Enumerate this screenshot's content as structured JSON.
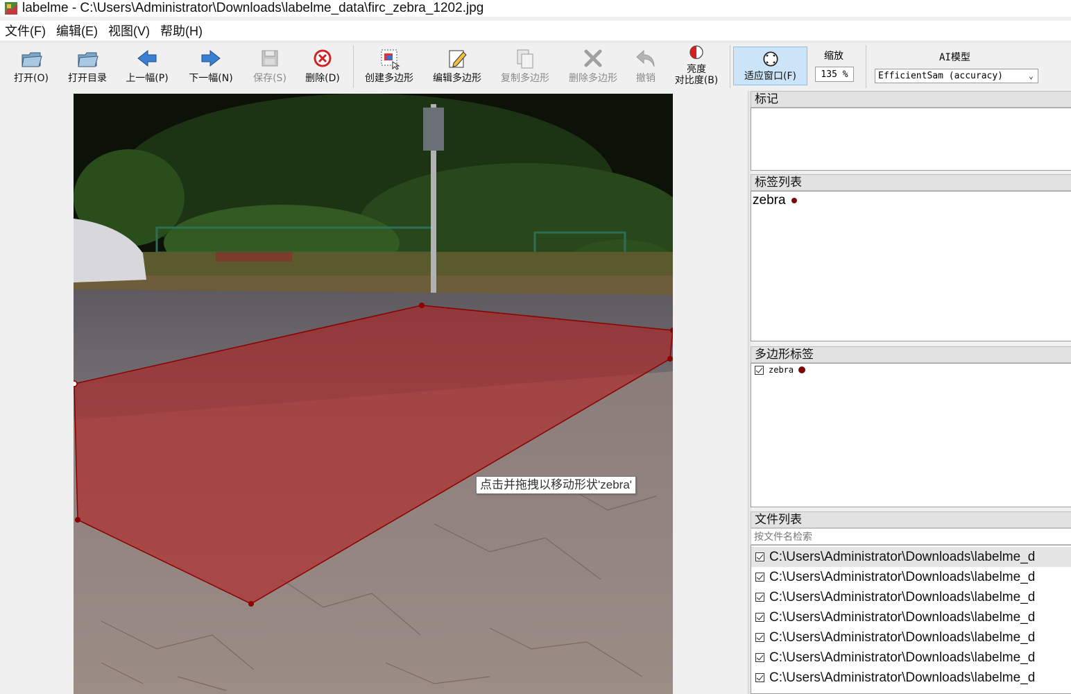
{
  "window": {
    "title": "labelme - C:\\Users\\Administrator\\Downloads\\labelme_data\\firc_zebra_1202.jpg"
  },
  "menu": [
    "文件(F)",
    "编辑(E)",
    "视图(V)",
    "帮助(H)"
  ],
  "toolbar": {
    "open": "打开(O)",
    "open_dir": "打开目录",
    "prev": "上一幅(P)",
    "next": "下一幅(N)",
    "save": "保存(S)",
    "delete": "删除(D)",
    "create_polygon": "创建多边形",
    "edit_polygon": "编辑多边形",
    "copy_polygon": "复制多边形",
    "delete_polygon": "删除多边形",
    "undo": "撤销",
    "brightness_line1": "亮度",
    "brightness_line2": "对比度(B)",
    "fit_window": "适应窗口(F)",
    "zoom_label": "缩放",
    "zoom_value": "135 %",
    "ai_label": "AI模型",
    "ai_model": "EfficientSam (accuracy)"
  },
  "canvas": {
    "tooltip": "点击并拖拽以移动形状'zebra'",
    "shape_label": "zebra",
    "shape_color": "#8b0000"
  },
  "docks": {
    "flags_title": "标记",
    "label_list_title": "标签列表",
    "label_list_items": [
      "zebra"
    ],
    "polygon_labels_title": "多边形标签",
    "polygon_labels_items": [
      "zebra"
    ],
    "file_list_title": "文件列表",
    "file_search_placeholder": "按文件名检索",
    "file_list": [
      "C:\\Users\\Administrator\\Downloads\\labelme_d",
      "C:\\Users\\Administrator\\Downloads\\labelme_d",
      "C:\\Users\\Administrator\\Downloads\\labelme_d",
      "C:\\Users\\Administrator\\Downloads\\labelme_d",
      "C:\\Users\\Administrator\\Downloads\\labelme_d",
      "C:\\Users\\Administrator\\Downloads\\labelme_d",
      "C:\\Users\\Administrator\\Downloads\\labelme_d"
    ]
  }
}
